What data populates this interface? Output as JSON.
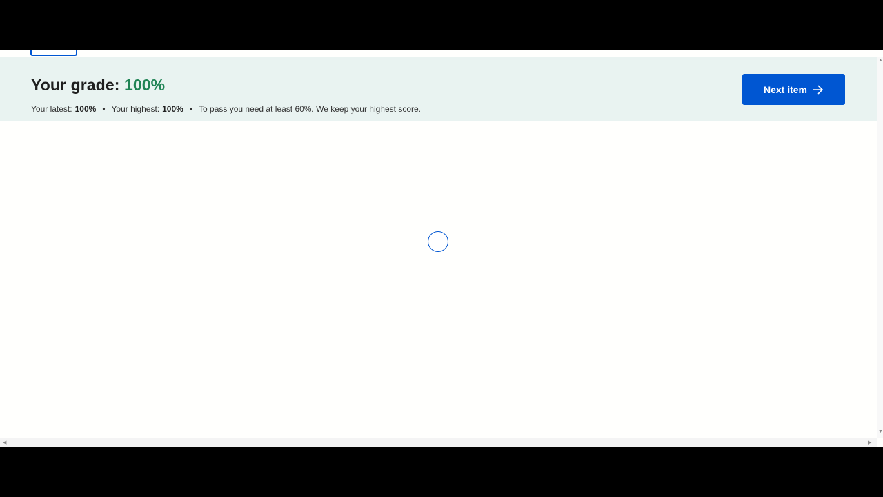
{
  "grade": {
    "title_prefix": "Your grade: ",
    "value": "100%",
    "value_color": "#1f8354",
    "latest_label": "Your latest:",
    "latest_value": "100%",
    "highest_label": "Your highest:",
    "highest_value": "100%",
    "separator": "•",
    "pass_note": "To pass you need at least 60%. We keep your highest score."
  },
  "actions": {
    "next_label": "Next item",
    "next_icon": "arrow-right-icon",
    "accent_color": "#0056d2"
  },
  "content": {
    "loading_icon": "loading-spinner-icon"
  }
}
